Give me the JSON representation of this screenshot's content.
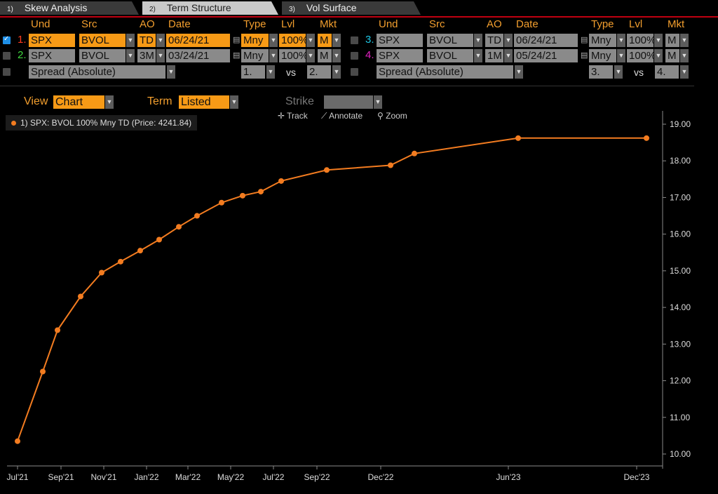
{
  "tabs": [
    {
      "num": "1)",
      "label": "Skew Analysis"
    },
    {
      "num": "2)",
      "label": "Term Structure"
    },
    {
      "num": "3)",
      "label": "Vol Surface"
    }
  ],
  "headers": {
    "und": "Und",
    "src": "Src",
    "ao": "AO",
    "date": "Date",
    "type": "Type",
    "lvl": "Lvl",
    "mkt": "Mkt"
  },
  "rows": [
    {
      "num": "1.",
      "und": "SPX",
      "src": "BVOL",
      "ao": "TD",
      "date": "06/24/21",
      "type": "Mny",
      "lvl": "100%",
      "mkt": "M"
    },
    {
      "num": "2.",
      "und": "SPX",
      "src": "BVOL",
      "ao": "3M",
      "date": "03/24/21",
      "type": "Mny",
      "lvl": "100%",
      "mkt": "M"
    },
    {
      "num": "3.",
      "und": "SPX",
      "src": "BVOL",
      "ao": "TD",
      "date": "06/24/21",
      "type": "Mny",
      "lvl": "100%",
      "mkt": "M"
    },
    {
      "num": "4.",
      "und": "SPX",
      "src": "BVOL",
      "ao": "1M",
      "date": "05/24/21",
      "type": "Mny",
      "lvl": "100%",
      "mkt": "M"
    }
  ],
  "spread": {
    "label": "Spread (Absolute)",
    "a": "1.",
    "b": "2.",
    "c": "3.",
    "d": "4.",
    "vs": "vs"
  },
  "view": {
    "view_label": "View",
    "view_value": "Chart",
    "term_label": "Term",
    "term_value": "Listed",
    "strike_label": "Strike"
  },
  "tools": {
    "track": "Track",
    "annotate": "Annotate",
    "zoom": "Zoom"
  },
  "colors": {
    "accent": "#f79a16",
    "series": "#f37c20",
    "num2": "#3fd63f",
    "num3": "#1ec8e6",
    "num4": "#e020c0",
    "num1": "#ff3b1f"
  },
  "chart_data": {
    "type": "line",
    "series": [
      {
        "name": "1) SPX: BVOL 100% Mny TD (Price: 4241.84)",
        "x": [
          "2021-07-01",
          "2021-08-06",
          "2021-08-27",
          "2021-09-29",
          "2021-10-29",
          "2021-11-25",
          "2021-12-23",
          "2022-01-19",
          "2022-02-16",
          "2022-03-14",
          "2022-04-18",
          "2022-05-18",
          "2022-06-13",
          "2022-07-12",
          "2022-09-15",
          "2022-12-15",
          "2023-01-18",
          "2023-06-15",
          "2023-12-15"
        ],
        "y": [
          10.35,
          12.25,
          13.38,
          14.3,
          14.95,
          15.25,
          15.55,
          15.85,
          16.2,
          16.5,
          16.86,
          17.05,
          17.16,
          17.45,
          17.75,
          17.88,
          18.2,
          18.62,
          18.62
        ]
      }
    ],
    "x_ticks": [
      "Jul'21",
      "Sep'21",
      "Nov'21",
      "Jan'22",
      "Mar'22",
      "May'22",
      "Jul'22",
      "Sep'22",
      "Dec'22",
      "Jun'23",
      "Dec'23"
    ],
    "x_tick_dates": [
      "2021-07-01",
      "2021-09-01",
      "2021-11-01",
      "2022-01-01",
      "2022-03-01",
      "2022-05-01",
      "2022-07-01",
      "2022-09-01",
      "2022-12-01",
      "2023-06-01",
      "2023-12-01"
    ],
    "y_ticks": [
      "10.00",
      "11.00",
      "12.00",
      "13.00",
      "14.00",
      "15.00",
      "16.00",
      "17.00",
      "18.00",
      "19.00"
    ],
    "ylim": [
      9.7,
      19.3
    ],
    "xlim": [
      "2021-06-20",
      "2023-12-25"
    ],
    "grid": false,
    "legend": "top-left"
  }
}
